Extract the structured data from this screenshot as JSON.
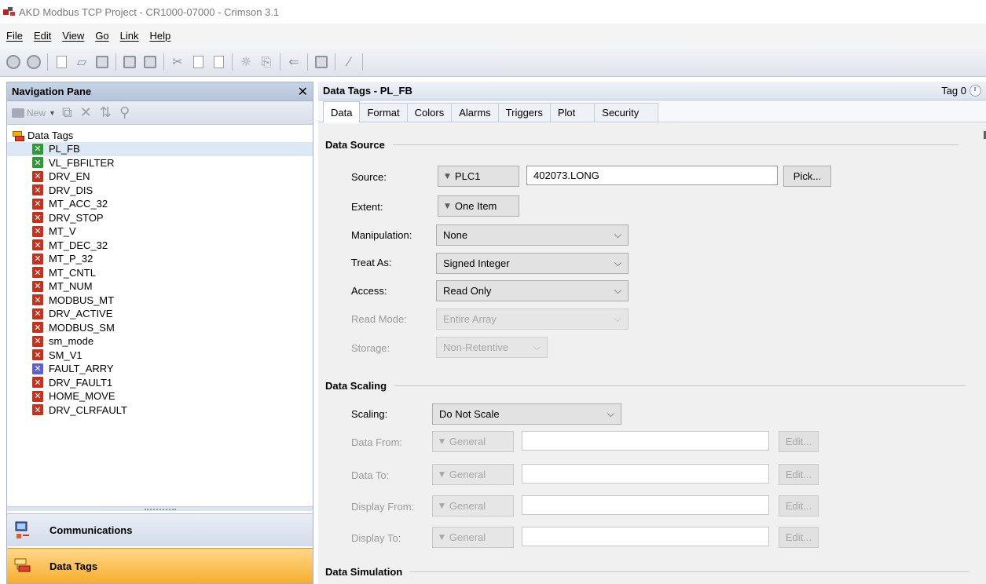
{
  "window": {
    "title": "AKD Modbus TCP Project - CR1000-07000 - Crimson 3.1"
  },
  "menu": [
    "File",
    "Edit",
    "View",
    "Go",
    "Link",
    "Help"
  ],
  "toolbar": {
    "icons": [
      "back-icon",
      "forward-icon",
      "new-file-icon",
      "open-icon",
      "save-icon",
      "undo-icon",
      "redo-icon",
      "cut-icon",
      "copy-icon",
      "paste-icon",
      "find-icon",
      "replace-icon",
      "link-icon",
      "window-icon",
      "tools-icon"
    ]
  },
  "nav": {
    "title": "Navigation Pane",
    "new_label": "New",
    "root_label": "Data Tags",
    "items": [
      {
        "label": "PL_FB",
        "status": "green",
        "selected": true
      },
      {
        "label": "VL_FBFILTER",
        "status": "green"
      },
      {
        "label": "DRV_EN",
        "status": "red"
      },
      {
        "label": "DRV_DIS",
        "status": "red"
      },
      {
        "label": "MT_ACC_32",
        "status": "red"
      },
      {
        "label": "DRV_STOP",
        "status": "red"
      },
      {
        "label": "MT_V",
        "status": "red"
      },
      {
        "label": "MT_DEC_32",
        "status": "red"
      },
      {
        "label": "MT_P_32",
        "status": "red"
      },
      {
        "label": "MT_CNTL",
        "status": "red"
      },
      {
        "label": "MT_NUM",
        "status": "red"
      },
      {
        "label": "MODBUS_MT",
        "status": "red"
      },
      {
        "label": "DRV_ACTIVE",
        "status": "red"
      },
      {
        "label": "MODBUS_SM",
        "status": "red"
      },
      {
        "label": "sm_mode",
        "status": "red"
      },
      {
        "label": "SM_V1",
        "status": "red"
      },
      {
        "label": "FAULT_ARRY",
        "status": "blue"
      },
      {
        "label": "DRV_FAULT1",
        "status": "red"
      },
      {
        "label": "HOME_MOVE",
        "status": "red"
      },
      {
        "label": "DRV_CLRFAULT",
        "status": "red"
      }
    ],
    "sections": {
      "communications": "Communications",
      "data_tags": "Data Tags"
    }
  },
  "editor": {
    "title": "Data Tags - PL_FB",
    "tag_indicator": "Tag 0",
    "tabs": [
      "Data",
      "Format",
      "Colors",
      "Alarms",
      "Triggers",
      "Plot",
      "Security"
    ],
    "active_tab": "Data",
    "data_source": {
      "title": "Data Source",
      "source_label": "Source:",
      "source_device": "PLC1",
      "source_address": "402073.LONG",
      "pick_label": "Pick...",
      "extent_label": "Extent:",
      "extent_value": "One Item",
      "manipulation_label": "Manipulation:",
      "manipulation_value": "None",
      "treat_as_label": "Treat As:",
      "treat_as_value": "Signed Integer",
      "access_label": "Access:",
      "access_value": "Read Only",
      "read_mode_label": "Read Mode:",
      "read_mode_value": "Entire Array",
      "storage_label": "Storage:",
      "storage_value": "Non-Retentive"
    },
    "data_scaling": {
      "title": "Data Scaling",
      "scaling_label": "Scaling:",
      "scaling_value": "Do Not Scale",
      "rows": [
        {
          "label": "Data From:",
          "type": "General",
          "value": "",
          "edit": "Edit..."
        },
        {
          "label": "Data To:",
          "type": "General",
          "value": "",
          "edit": "Edit..."
        },
        {
          "label": "Display From:",
          "type": "General",
          "value": "",
          "edit": "Edit..."
        },
        {
          "label": "Display To:",
          "type": "General",
          "value": "",
          "edit": "Edit..."
        }
      ]
    },
    "data_simulation": {
      "title": "Data Simulation"
    }
  },
  "colors": {
    "tag_ok": "#2f9a32",
    "tag_error": "#c8301e",
    "tag_array": "#5b5fd8",
    "active_section": "#f6ae2d",
    "nav_header": "#b5c4da"
  }
}
